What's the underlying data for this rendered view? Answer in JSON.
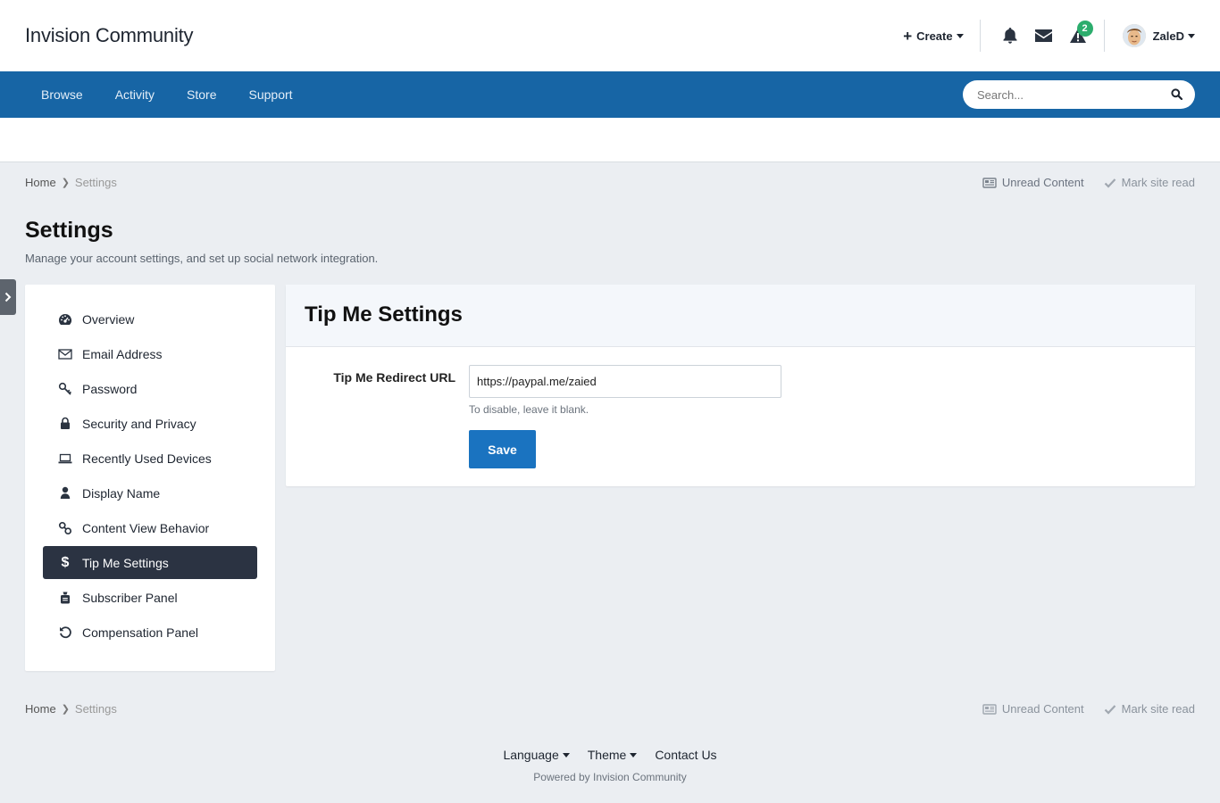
{
  "site": {
    "title": "Invision Community"
  },
  "userbar": {
    "create_label": "Create",
    "alerts_badge": "2",
    "username": "ZaleD"
  },
  "nav": {
    "items": [
      "Browse",
      "Activity",
      "Store",
      "Support"
    ],
    "search_placeholder": "Search..."
  },
  "breadcrumb": {
    "home": "Home",
    "current": "Settings",
    "unread_label": "Unread Content",
    "mark_read_label": "Mark site read"
  },
  "page": {
    "title": "Settings",
    "description": "Manage your account settings, and set up social network integration."
  },
  "menu": {
    "items": [
      {
        "label": "Overview",
        "icon": "dashboard-icon"
      },
      {
        "label": "Email Address",
        "icon": "envelope-icon"
      },
      {
        "label": "Password",
        "icon": "key-icon"
      },
      {
        "label": "Security and Privacy",
        "icon": "lock-icon"
      },
      {
        "label": "Recently Used Devices",
        "icon": "laptop-icon"
      },
      {
        "label": "Display Name",
        "icon": "user-icon"
      },
      {
        "label": "Content View Behavior",
        "icon": "link-icon"
      },
      {
        "label": "Tip Me Settings",
        "icon": "dollar-icon",
        "active": true
      },
      {
        "label": "Subscriber Panel",
        "icon": "subscriber-icon"
      },
      {
        "label": "Compensation Panel",
        "icon": "undo-icon"
      }
    ]
  },
  "panel": {
    "title": "Tip Me Settings",
    "field_label": "Tip Me Redirect URL",
    "field_value": "https://paypal.me/zaied",
    "field_hint": "To disable, leave it blank.",
    "save_label": "Save"
  },
  "footer": {
    "language_label": "Language",
    "theme_label": "Theme",
    "contact_label": "Contact Us",
    "powered_by": "Powered by Invision Community"
  },
  "colors": {
    "navbar": "#1765a5",
    "active_menu": "#2b3342",
    "primary_button": "#1a73c0",
    "badge": "#2cad6d"
  }
}
